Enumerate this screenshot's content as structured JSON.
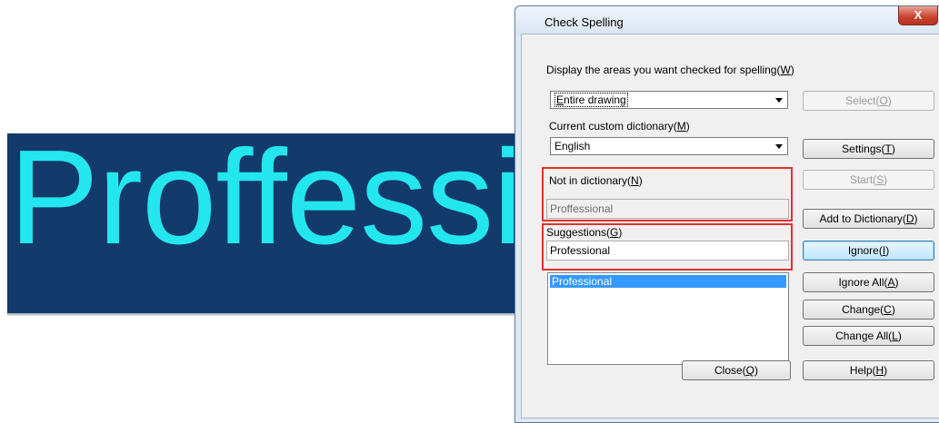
{
  "canvas": {
    "text": "Proffessi"
  },
  "dialog": {
    "title": "Check Spelling",
    "close_label": "X",
    "areas_label_pre": "Display the areas you want checked for spelling(",
    "areas_label_key": "W",
    "areas_label_post": ")",
    "areas_value_pre": "",
    "areas_value_key": "E",
    "areas_value_post": "ntire drawing",
    "select_pre": "Select(",
    "select_key": "O",
    "select_post": ")",
    "dict_label_pre": "Current custom dictionary(",
    "dict_label_key": "M",
    "dict_label_post": ")",
    "dict_value": "English",
    "settings_pre": "Settings(",
    "settings_key": "T",
    "settings_post": ")",
    "notin_label_pre": "Not in dictionary(",
    "notin_label_key": "N",
    "notin_label_post": ")",
    "notin_value": "Proffessional",
    "start_pre": "Start(",
    "start_key": "S",
    "start_post": ")",
    "add_dict_pre": "Add to Dictionary(",
    "add_dict_key": "D",
    "add_dict_post": ")",
    "suggest_label_pre": "Suggestions(",
    "suggest_label_key": "G",
    "suggest_label_post": ")",
    "suggest_value": "Professional",
    "ignore_pre": "Ignore(",
    "ignore_key": "I",
    "ignore_post": ")",
    "ignore_all_pre": "Ignore All(",
    "ignore_all_key": "A",
    "ignore_all_post": ")",
    "change_pre": "Change(",
    "change_key": "C",
    "change_post": ")",
    "change_all_pre": "Change All(",
    "change_all_key": "L",
    "change_all_post": ")",
    "close_pre": "Close(",
    "close_key": "Q",
    "close_post": ")",
    "help_pre": "Help(",
    "help_key": "H",
    "help_post": ")",
    "suggestions_list": [
      "Professional"
    ],
    "highlight_color": "#e0322e"
  }
}
